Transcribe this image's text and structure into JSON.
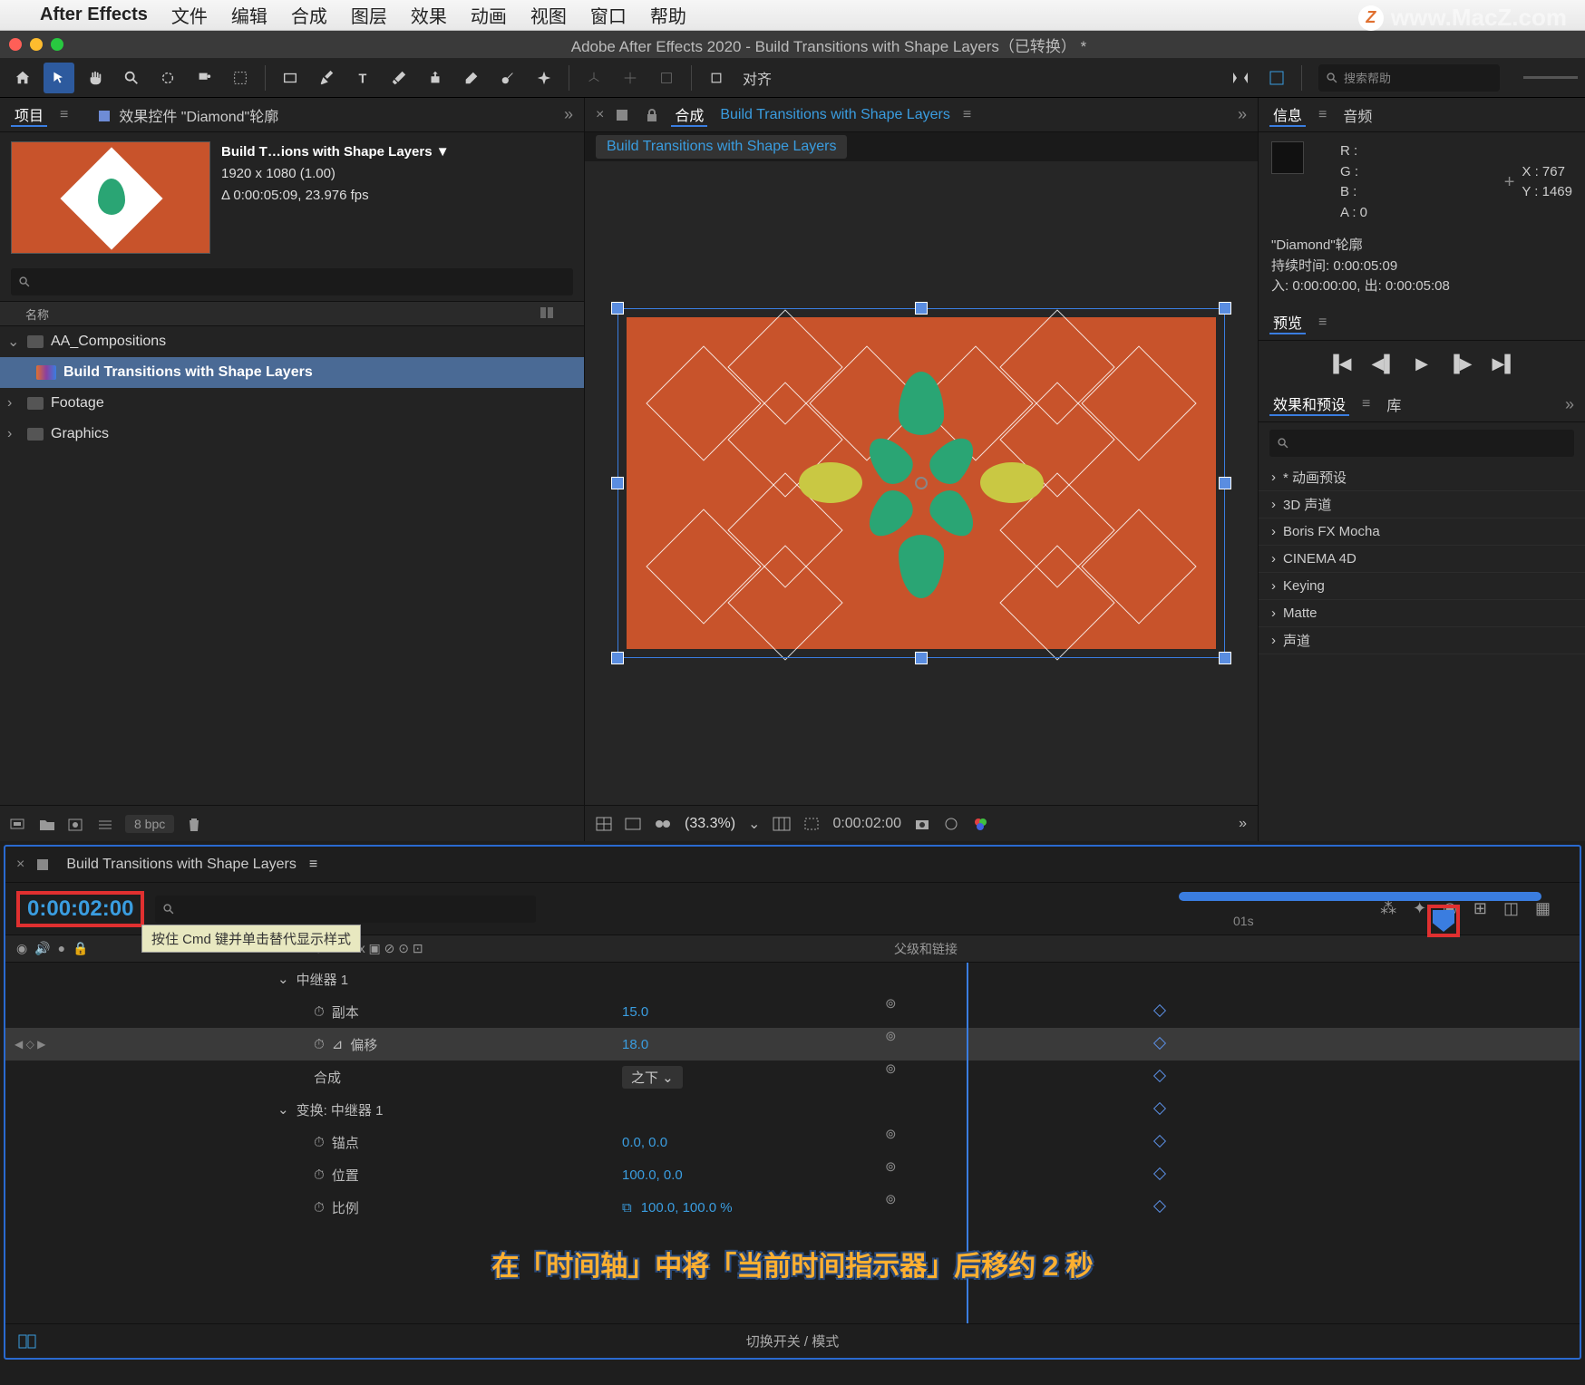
{
  "menubar": {
    "app": "After Effects",
    "items": [
      "文件",
      "编辑",
      "合成",
      "图层",
      "效果",
      "动画",
      "视图",
      "窗口",
      "帮助"
    ]
  },
  "watermark": "www.MacZ.com",
  "titlebar": "Adobe After Effects 2020 - Build Transitions with Shape Layers（已转换） *",
  "toolbar": {
    "align_label": "对齐",
    "search_placeholder": "搜索帮助"
  },
  "project": {
    "tab_project": "项目",
    "tab_effects": "效果控件 \"Diamond\"轮廓",
    "comp_name": "Build T…ions with Shape Layers ▼",
    "resolution": "1920 x 1080 (1.00)",
    "duration": "Δ 0:00:05:09, 23.976 fps",
    "search_placeholder": "",
    "col_name": "名称",
    "folders": [
      {
        "name": "AA_Compositions",
        "open": true,
        "children": [
          {
            "name": "Build Transitions with Shape Layers",
            "type": "comp",
            "selected": true
          }
        ]
      },
      {
        "name": "Footage",
        "open": false
      },
      {
        "name": "Graphics",
        "open": false
      }
    ],
    "bpc": "8 bpc"
  },
  "composition": {
    "tab": "合成",
    "comp_link": "Build Transitions with Shape Layers",
    "breadcrumb": "Build Transitions with Shape Layers",
    "zoom": "(33.3%)",
    "time": "0:00:02:00"
  },
  "info": {
    "tab_info": "信息",
    "tab_audio": "音频",
    "rgb": {
      "R": "R :",
      "G": "G :",
      "B": "B :",
      "A": "A :  0"
    },
    "xy": {
      "X": "X : 767",
      "Y": "Y : 1469"
    },
    "layer": "\"Diamond\"轮廓",
    "dur": "持续时间: 0:00:05:09",
    "inout": "入: 0:00:00:00,   出: 0:00:05:08"
  },
  "preview": {
    "tab": "预览"
  },
  "effects": {
    "tab_eff": "效果和预设",
    "tab_lib": "库",
    "items": [
      "* 动画预设",
      "3D 声道",
      "Boris FX Mocha",
      "CINEMA 4D",
      "Keying",
      "Matte",
      "声道"
    ]
  },
  "timeline": {
    "tab": "Build Transitions with Shape Layers",
    "timecode": "0:00:02:00",
    "tooltip": "按住 Cmd 键并单击替代显示样式",
    "ruler_label": "01s",
    "col_switches": "⊕ ✱ ⎌ fx ▣ ⊘ ⊙ ⊡",
    "col_parent": "父级和链接",
    "rows": [
      {
        "indent": 0,
        "arrow": "⌄",
        "label": "中继器 1",
        "value": "",
        "link": ""
      },
      {
        "indent": 1,
        "stopwatch": true,
        "label": "副本",
        "value": "15.0",
        "link": "⊚"
      },
      {
        "indent": 1,
        "stopwatch": true,
        "graph": true,
        "label": "偏移",
        "value": "18.0",
        "link": "⊚",
        "selected": true,
        "kf": true
      },
      {
        "indent": 1,
        "label": "合成",
        "value_dropdown": "之下",
        "link": "⊚"
      },
      {
        "indent": 0,
        "arrow": "⌄",
        "label": "变换: 中继器 1",
        "value": "",
        "link": ""
      },
      {
        "indent": 1,
        "stopwatch": true,
        "label": "锚点",
        "value": "0.0, 0.0",
        "link": "⊚"
      },
      {
        "indent": 1,
        "stopwatch": true,
        "label": "位置",
        "value": "100.0, 0.0",
        "link": "⊚"
      },
      {
        "indent": 1,
        "stopwatch": true,
        "label": "比例",
        "value": "100.0, 100.0 %",
        "link": "⊚",
        "chain": true
      }
    ],
    "foot": "切换开关 / 模式",
    "caption": "在「时间轴」中将「当前时间指示器」后移约 2 秒"
  }
}
